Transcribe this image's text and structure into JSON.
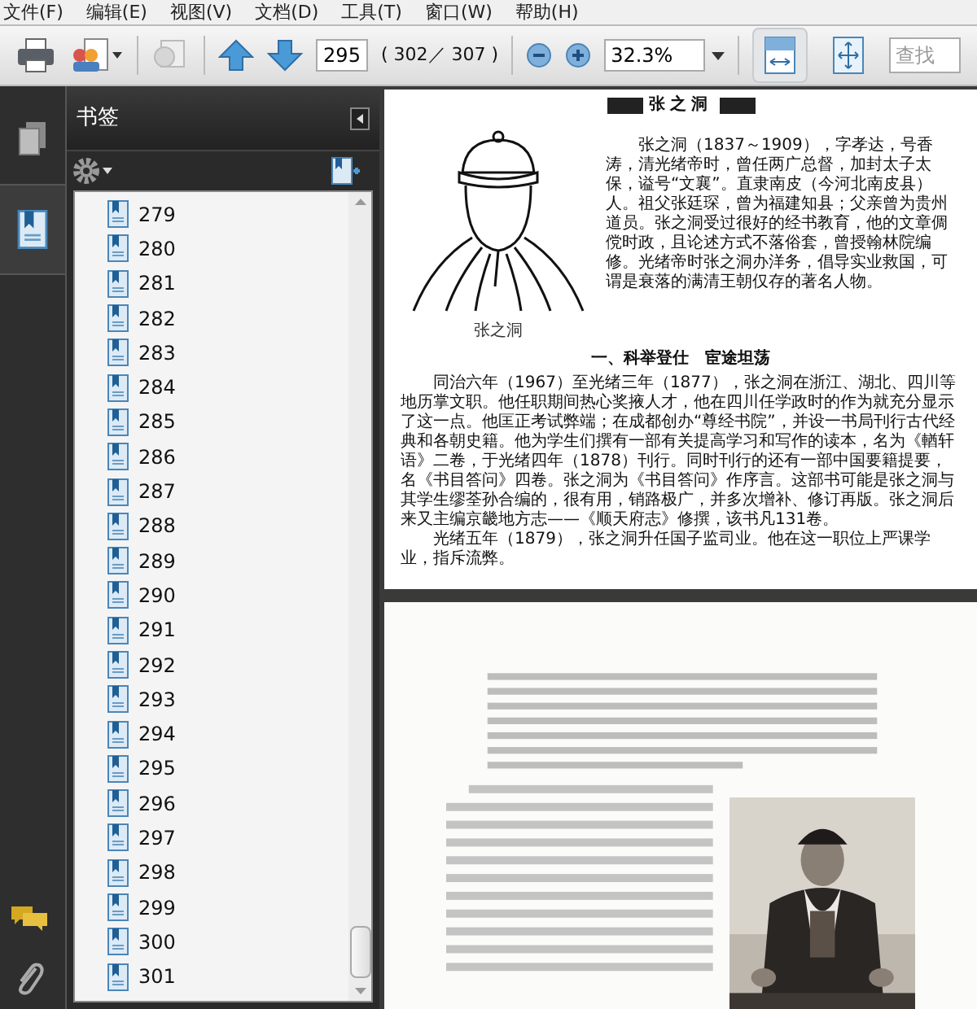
{
  "menu": [
    "文件(F)",
    "编辑(E)",
    "视图(V)",
    "文档(D)",
    "工具(T)",
    "窗口(W)",
    "帮助(H)"
  ],
  "toolbar": {
    "page_input": "295",
    "page_count": "( 302／ 307 )",
    "zoom": "32.3%",
    "search": {
      "placeholder": "查找"
    },
    "view_buttons": [
      {
        "kind": "fit-width",
        "selected": true
      },
      {
        "kind": "fit-page",
        "selected": false
      }
    ]
  },
  "sidebar": {
    "tabs": [
      {
        "kind": "pages",
        "selected": false
      },
      {
        "kind": "bookmarks",
        "selected": true
      }
    ],
    "panel_title": "书签",
    "bookmarks": [
      {
        "label": "279"
      },
      {
        "label": "280"
      },
      {
        "label": "281"
      },
      {
        "label": "282"
      },
      {
        "label": "283"
      },
      {
        "label": "284"
      },
      {
        "label": "285"
      },
      {
        "label": "286"
      },
      {
        "label": "287"
      },
      {
        "label": "288"
      },
      {
        "label": "289"
      },
      {
        "label": "290"
      },
      {
        "label": "291"
      },
      {
        "label": "292"
      },
      {
        "label": "293"
      },
      {
        "label": "294"
      },
      {
        "label": "295"
      },
      {
        "label": "296"
      },
      {
        "label": "297"
      },
      {
        "label": "298"
      },
      {
        "label": "299"
      },
      {
        "label": "300"
      },
      {
        "label": "301"
      }
    ]
  },
  "document": {
    "page_title": "张之洞",
    "figure_caption": "张之洞",
    "intro": "张之洞（1837～1909），字孝达，号香涛，清光绪帝时，曾任两广总督，加封太子太保，谥号“文襄”。直隶南皮（今河北南皮县）人。祖父张廷琛，曾为福建知县；父亲曾为贵州道员。张之洞受过很好的经书教育，他的文章倜傥时政，且论述方式不落俗套，曾授翰林院编修。光绪帝时张之洞办洋务，倡导实业救国，可谓是衰落的满清王朝仅存的著名人物。",
    "section_heading": "一、科举登仕　宦途坦荡",
    "paragraphs": [
      "同治六年（1967）至光绪三年（1877），张之洞在浙江、湖北、四川等地历掌文职。他任职期间热心奖掖人才，他在四川任学政时的作为就充分显示了这一点。他匡正考试弊端；在成都创办“尊经书院”，并设一书局刊行古代经典和各朝史籍。他为学生们撰有一部有关提高学习和写作的读本，名为《輶轩语》二卷，于光绪四年（1878）刊行。同时刊行的还有一部中国要籍提要，名《书目答问》四卷。张之洞为《书目答问》作序言。这部书可能是张之洞与其学生缪荃孙合编的，很有用，销路极广，并多次增补、修订再版。张之洞后来又主编京畿地方志——《顺天府志》修撰，该书凡131卷。",
      "光绪五年（1879），张之洞升任国子监司业。他在这一职位上严课学业，指斥流弊。"
    ]
  }
}
